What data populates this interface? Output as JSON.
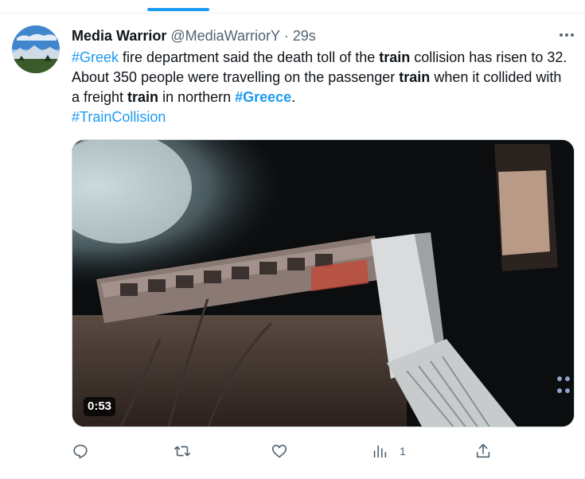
{
  "tweet": {
    "author_name": "Media Warrior",
    "author_handle": "@MediaWarriorY",
    "separator": "·",
    "timestamp": "29s",
    "text_segments": [
      {
        "text": "#Greek",
        "style": "hashtag"
      },
      {
        "text": " fire department said the death toll of the ",
        "style": "plain"
      },
      {
        "text": "train",
        "style": "bold"
      },
      {
        "text": " collision has risen to 32. About 350 people were travelling on the passenger ",
        "style": "plain"
      },
      {
        "text": "train",
        "style": "bold"
      },
      {
        "text": " when it collided with a freight ",
        "style": "plain"
      },
      {
        "text": "train",
        "style": "bold"
      },
      {
        "text": " in northern ",
        "style": "plain"
      },
      {
        "text": "#Greece",
        "style": "hashtag-bold"
      },
      {
        "text": ".",
        "style": "plain"
      },
      {
        "text": "#TrainCollision",
        "style": "hashtag-line"
      }
    ],
    "media": {
      "type": "video",
      "duration": "0:53"
    },
    "actions": {
      "reply_icon": "reply-icon",
      "retweet_icon": "retweet-icon",
      "like_icon": "heart-icon",
      "views_icon": "views-icon",
      "views_count": "1",
      "share_icon": "share-icon"
    }
  },
  "colors": {
    "accent": "#1d9bf0",
    "text_primary": "#0f1419",
    "text_secondary": "#536471",
    "border": "#eff3f4"
  }
}
